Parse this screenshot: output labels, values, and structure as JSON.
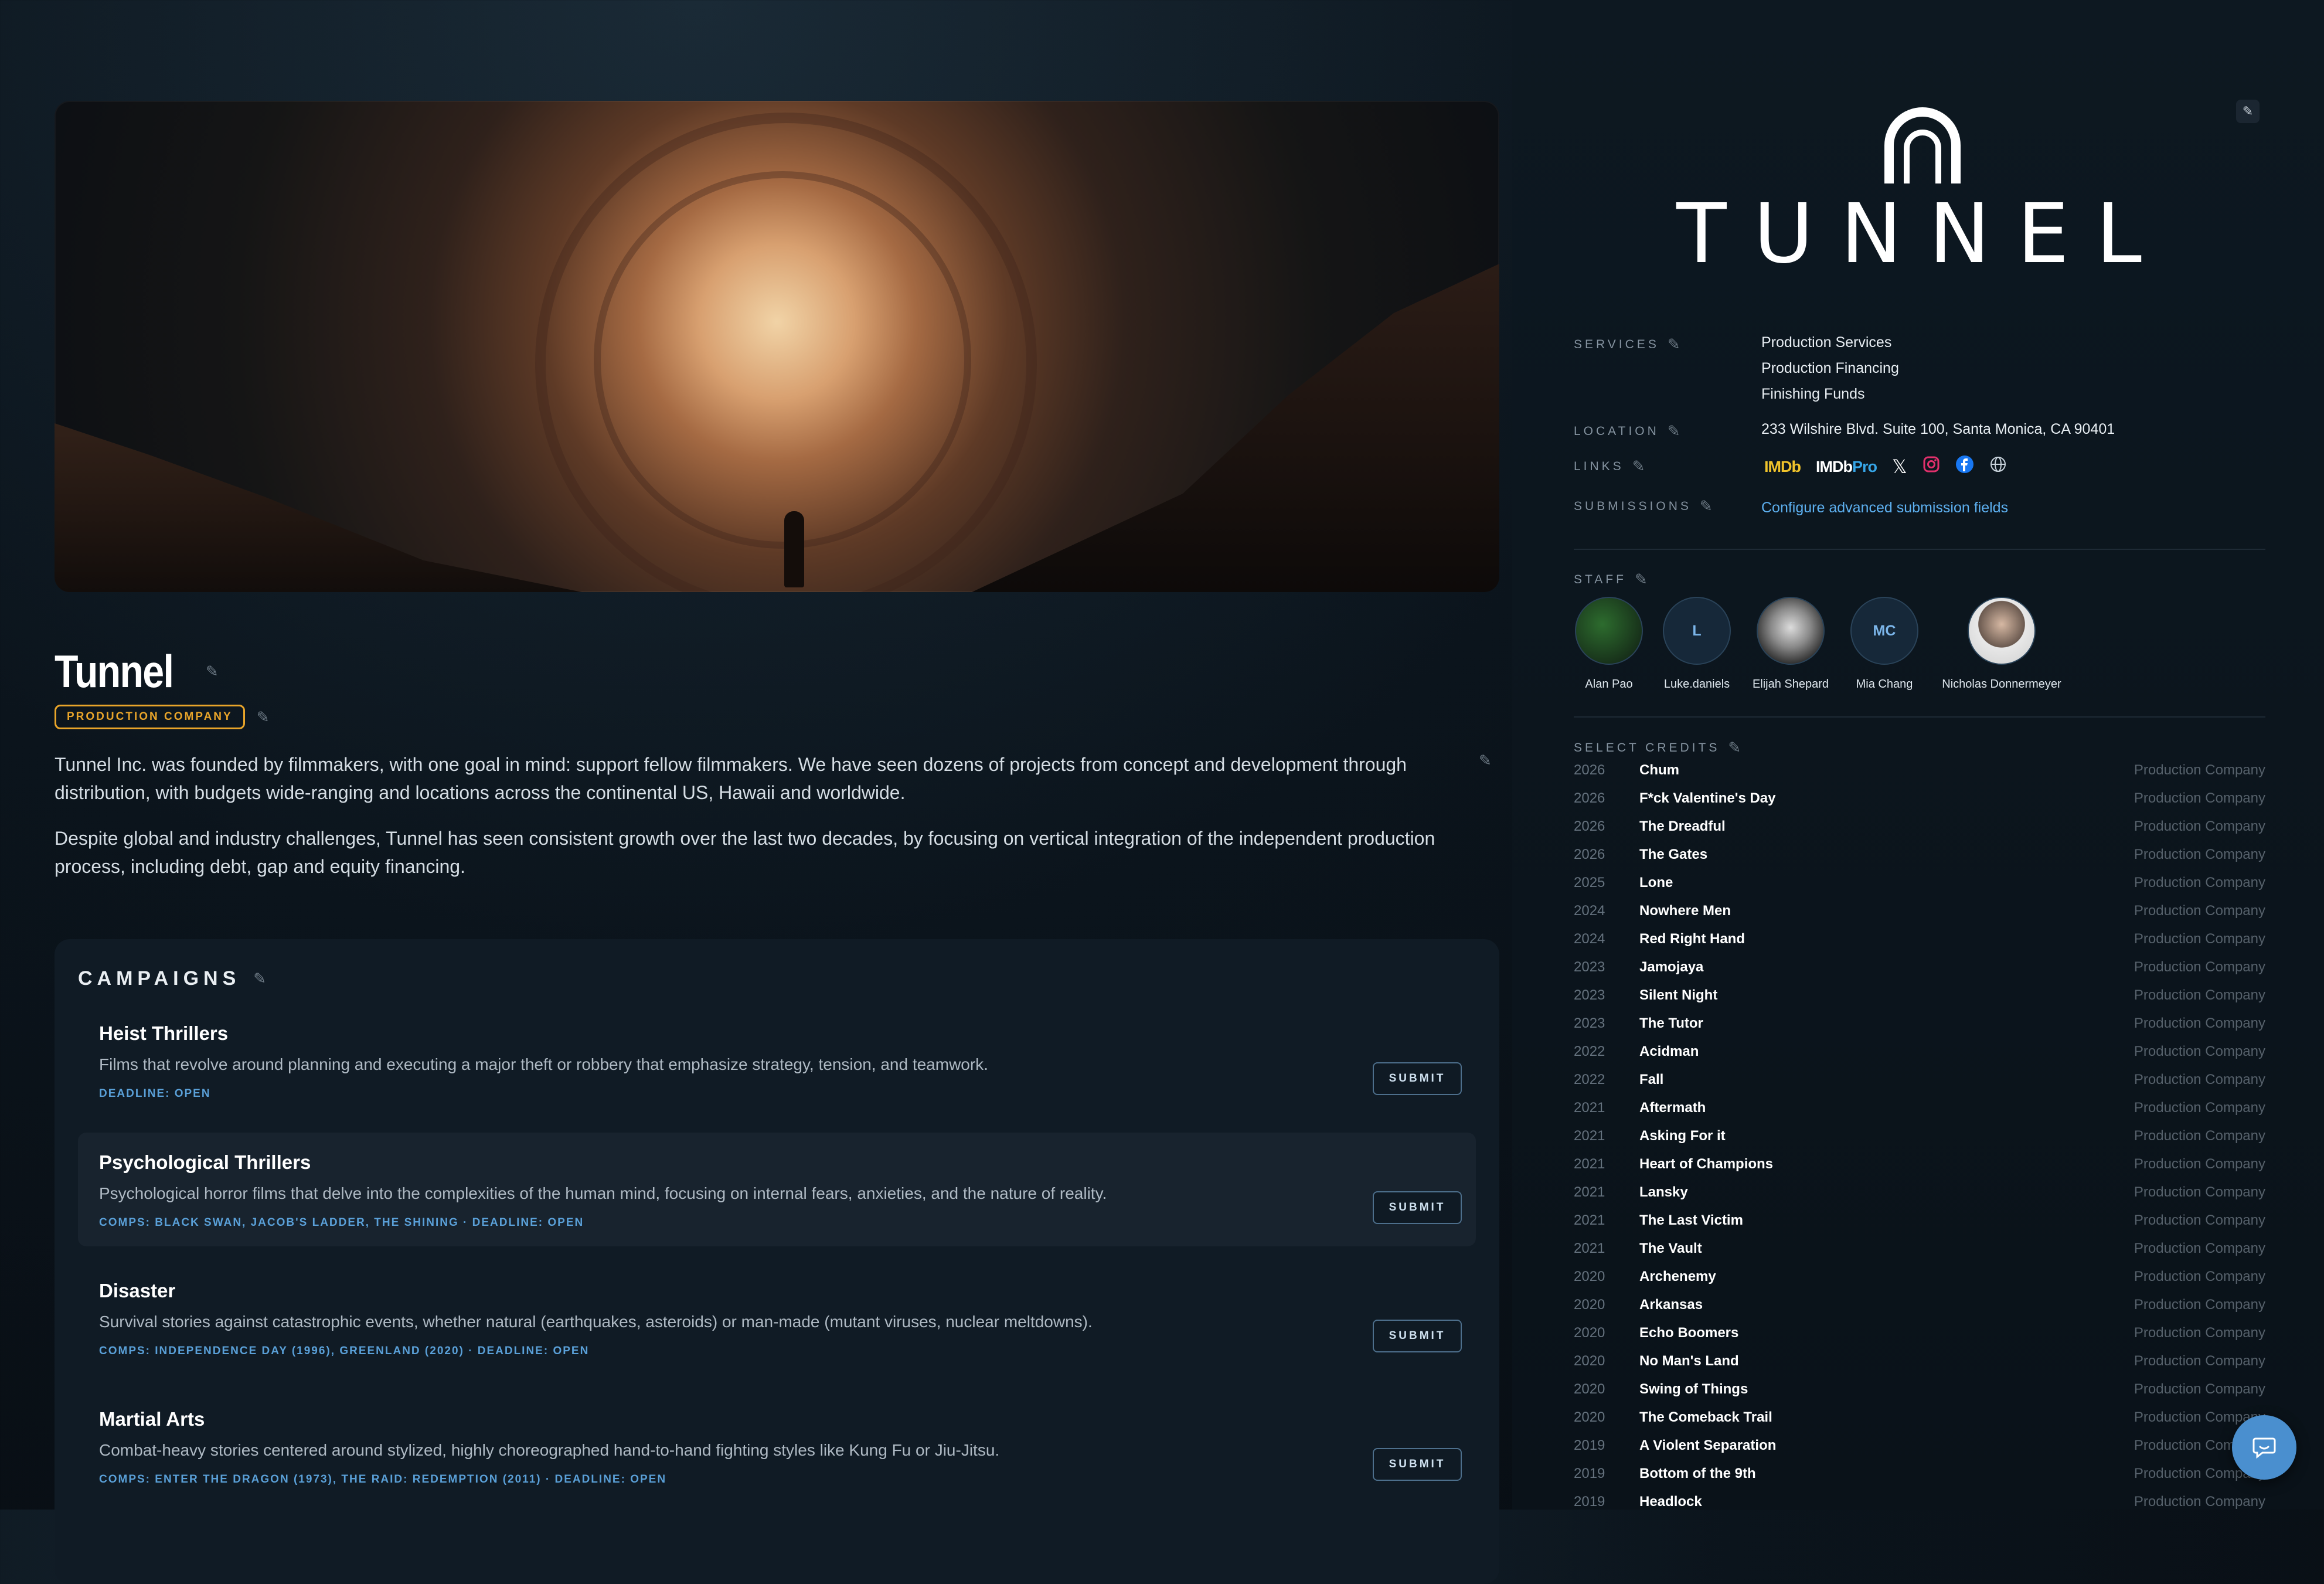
{
  "company": {
    "name": "Tunnel",
    "type_badge": "PRODUCTION COMPANY",
    "description": [
      "Tunnel Inc. was founded by filmmakers, with one goal in mind: support fellow filmmakers. We have seen dozens of projects from concept and development through distribution, with budgets wide-ranging and locations across the continental US, Hawaii and worldwide.",
      "Despite global and industry challenges, Tunnel has seen consistent growth over the last two decades, by focusing on vertical integration of the independent production process, including debt, gap and equity financing."
    ]
  },
  "campaigns": {
    "title": "CAMPAIGNS",
    "items": [
      {
        "title": "Heist Thrillers",
        "desc": "Films that revolve around planning and executing a major theft or robbery that emphasize strategy, tension, and teamwork.",
        "meta": "DEADLINE: OPEN",
        "button": "SUBMIT"
      },
      {
        "title": "Psychological Thrillers",
        "desc": "Psychological horror films that delve into the complexities of the human mind, focusing on internal fears, anxieties, and the nature of reality.",
        "meta": "COMPS: BLACK SWAN, JACOB'S LADDER, THE SHINING · DEADLINE: OPEN",
        "button": "SUBMIT"
      },
      {
        "title": "Disaster",
        "desc": "Survival stories against catastrophic events, whether natural (earthquakes, asteroids) or man-made (mutant viruses, nuclear meltdowns).",
        "meta": "COMPS: INDEPENDENCE DAY (1996), GREENLAND (2020) · DEADLINE: OPEN",
        "button": "SUBMIT"
      },
      {
        "title": "Martial Arts",
        "desc": "Combat-heavy stories centered around stylized, highly choreographed hand-to-hand fighting styles like Kung Fu or Jiu-Jitsu.",
        "meta": "COMPS: ENTER THE DRAGON (1973), THE RAID: REDEMPTION (2011) · DEADLINE: OPEN",
        "button": "SUBMIT"
      }
    ]
  },
  "sidebar": {
    "logo_text": "TUNNEL",
    "services_label": "SERVICES",
    "services": [
      "Production Services",
      "Production Financing",
      "Finishing Funds"
    ],
    "location_label": "LOCATION",
    "location": "233 Wilshire Blvd. Suite 100, Santa Monica, CA 90401",
    "links_label": "LINKS",
    "links": {
      "imdb": "IMDb",
      "imdbpro_a": "IMDb",
      "imdbpro_b": "Pro"
    },
    "submissions_label": "SUBMISSIONS",
    "submissions_link": "Configure advanced submission fields",
    "staff_label": "STAFF",
    "staff": [
      {
        "name": "Alan Pao",
        "initials": ""
      },
      {
        "name": "Luke.daniels",
        "initials": "L"
      },
      {
        "name": "Elijah Shepard",
        "initials": ""
      },
      {
        "name": "Mia Chang",
        "initials": "MC"
      },
      {
        "name": "Nicholas Donnermeyer",
        "initials": ""
      }
    ],
    "credits_label": "SELECT CREDITS",
    "credits": [
      {
        "year": "2026",
        "title": "Chum",
        "role": "Production Company"
      },
      {
        "year": "2026",
        "title": "F*ck Valentine's Day",
        "role": "Production Company"
      },
      {
        "year": "2026",
        "title": "The Dreadful",
        "role": "Production Company"
      },
      {
        "year": "2026",
        "title": "The Gates",
        "role": "Production Company"
      },
      {
        "year": "2025",
        "title": "Lone",
        "role": "Production Company"
      },
      {
        "year": "2024",
        "title": "Nowhere Men",
        "role": "Production Company"
      },
      {
        "year": "2024",
        "title": "Red Right Hand",
        "role": "Production Company"
      },
      {
        "year": "2023",
        "title": "Jamojaya",
        "role": "Production Company"
      },
      {
        "year": "2023",
        "title": "Silent Night",
        "role": "Production Company"
      },
      {
        "year": "2023",
        "title": "The Tutor",
        "role": "Production Company"
      },
      {
        "year": "2022",
        "title": "Acidman",
        "role": "Production Company"
      },
      {
        "year": "2022",
        "title": "Fall",
        "role": "Production Company"
      },
      {
        "year": "2021",
        "title": "Aftermath",
        "role": "Production Company"
      },
      {
        "year": "2021",
        "title": "Asking For it",
        "role": "Production Company"
      },
      {
        "year": "2021",
        "title": "Heart of Champions",
        "role": "Production Company"
      },
      {
        "year": "2021",
        "title": "Lansky",
        "role": "Production Company"
      },
      {
        "year": "2021",
        "title": "The Last Victim",
        "role": "Production Company"
      },
      {
        "year": "2021",
        "title": "The Vault",
        "role": "Production Company"
      },
      {
        "year": "2020",
        "title": "Archenemy",
        "role": "Production Company"
      },
      {
        "year": "2020",
        "title": "Arkansas",
        "role": "Production Company"
      },
      {
        "year": "2020",
        "title": "Echo Boomers",
        "role": "Production Company"
      },
      {
        "year": "2020",
        "title": "No Man's Land",
        "role": "Production Company"
      },
      {
        "year": "2020",
        "title": "Swing of Things",
        "role": "Production Company"
      },
      {
        "year": "2020",
        "title": "The Comeback Trail",
        "role": "Production Company"
      },
      {
        "year": "2019",
        "title": "A Violent Separation",
        "role": "Production Company"
      },
      {
        "year": "2019",
        "title": "Bottom of the 9th",
        "role": "Production Company"
      },
      {
        "year": "2019",
        "title": "Headlock",
        "role": "Production Company"
      }
    ]
  },
  "colors": {
    "accent": "#e9a52a",
    "link": "#5db0f0",
    "chat": "#4a8fcf"
  }
}
